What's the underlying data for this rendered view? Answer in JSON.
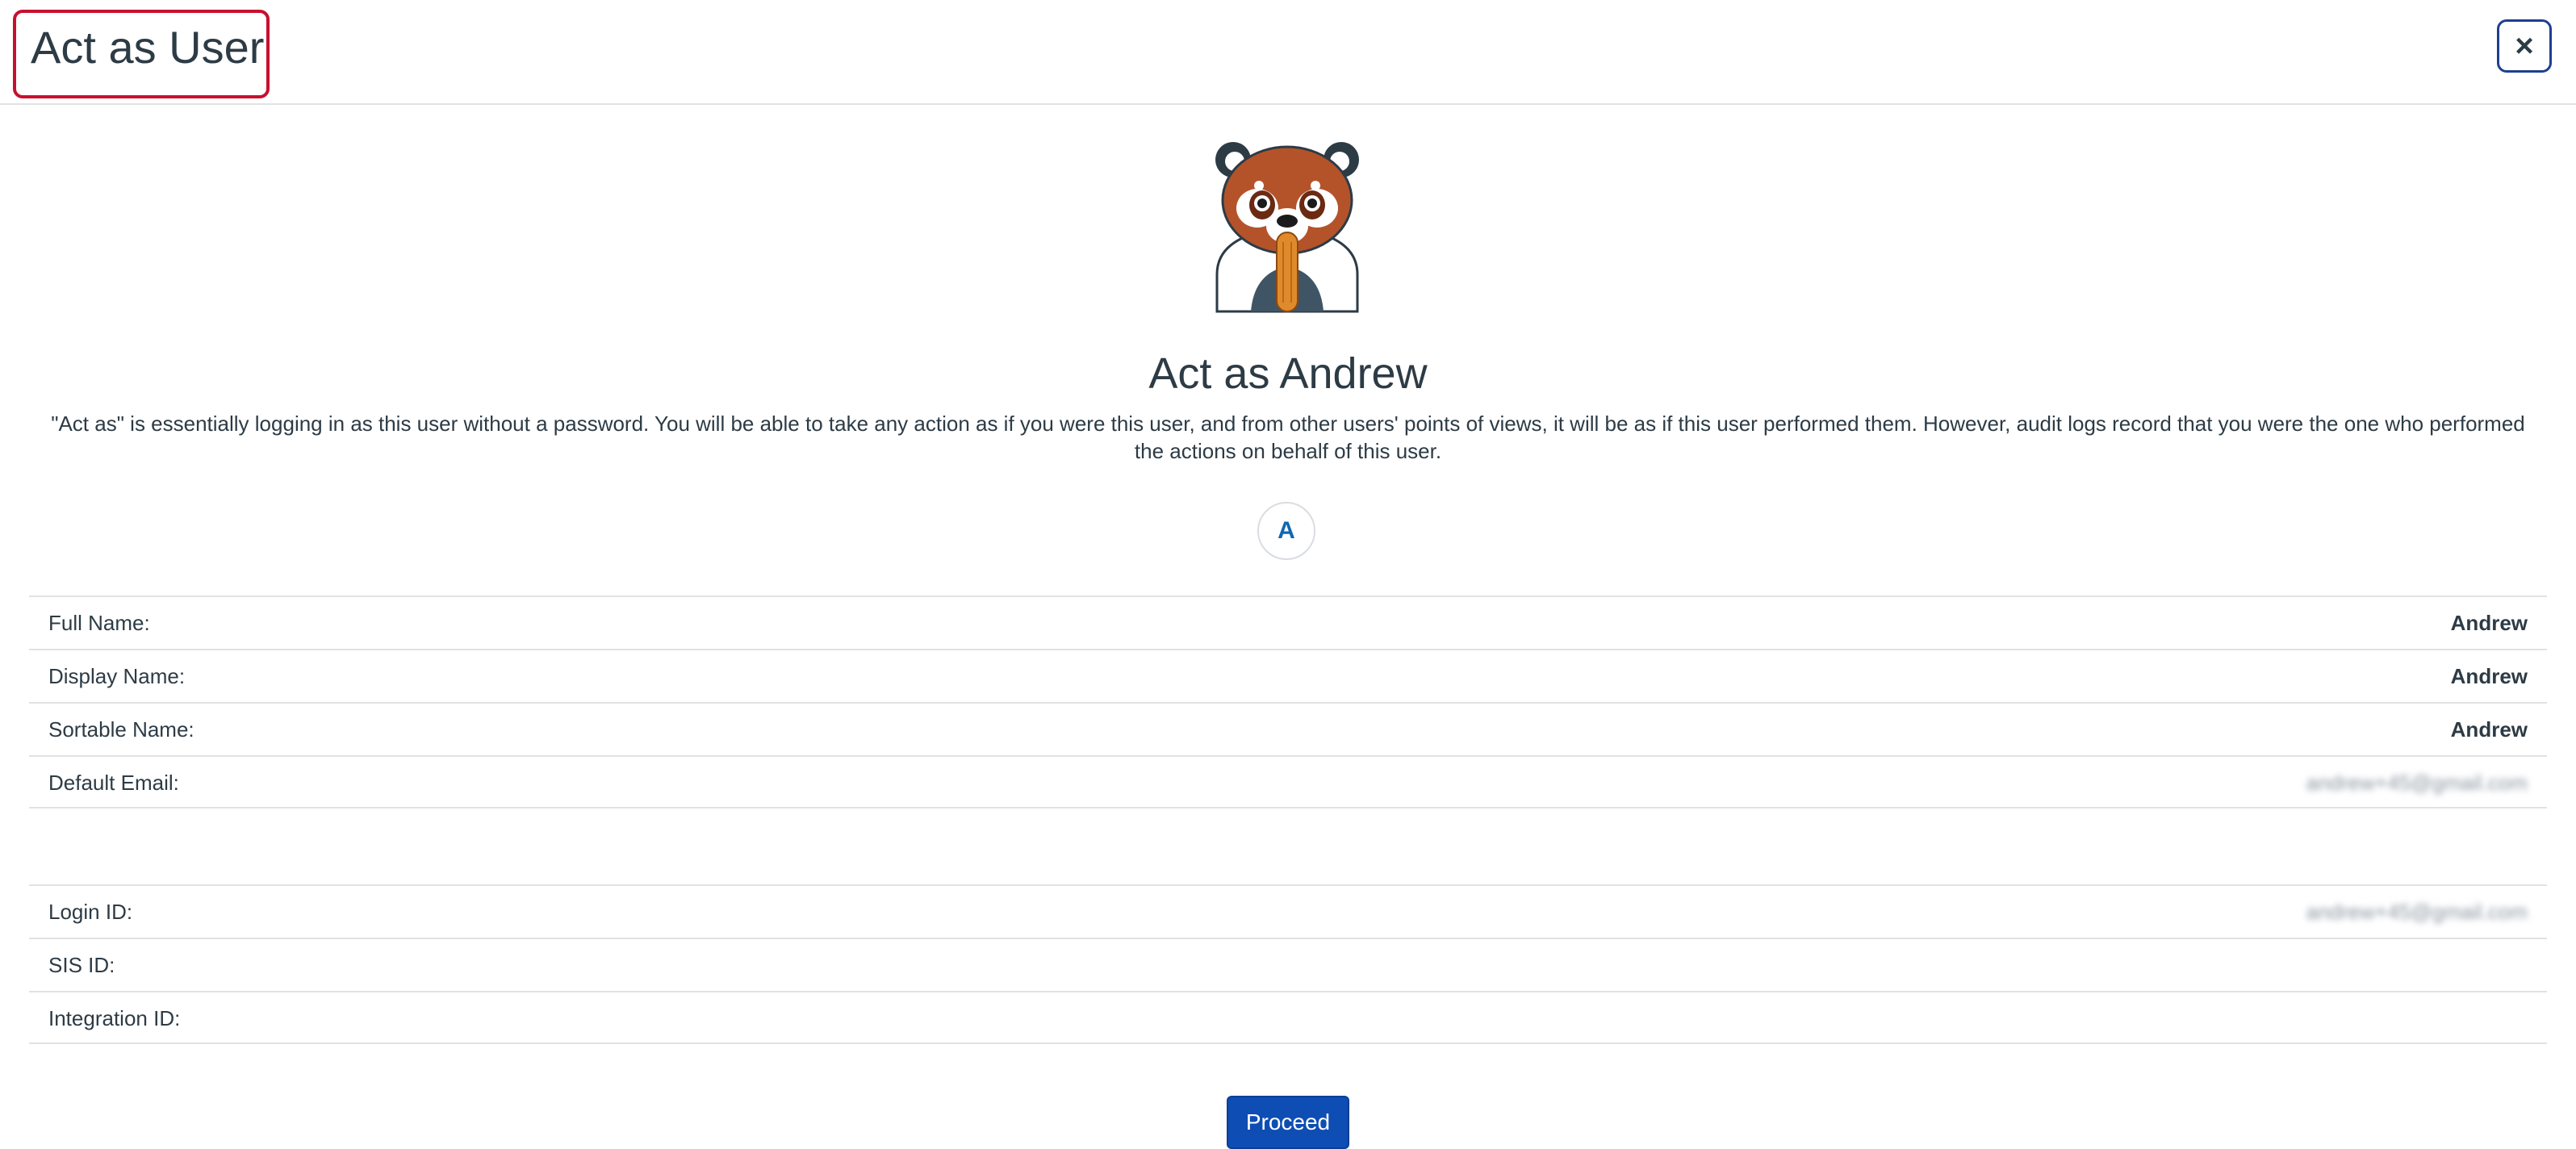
{
  "modal": {
    "title": "Act as User",
    "close_label": "×"
  },
  "user": {
    "heading": "Act as Andrew",
    "description": "\"Act as\" is essentially logging in as this user without a password. You will be able to take any action as if you were this user, and from other users' points of views, it will be as if this user performed them. However, audit logs record that you were the one who performed the actions on behalf of this user.",
    "avatar_initial": "A",
    "mascot_icon": "red-panda-icon"
  },
  "details": {
    "full_name_label": "Full Name:",
    "full_name": "Andrew",
    "display_name_label": "Display Name:",
    "display_name": "Andrew",
    "sortable_name_label": "Sortable Name:",
    "sortable_name": "Andrew",
    "default_email_label": "Default Email:",
    "default_email": "andrew+45@gmail.com",
    "login_id_label": "Login ID:",
    "login_id": "andrew+45@gmail.com",
    "sis_id_label": "SIS ID:",
    "sis_id": "",
    "integration_id_label": "Integration ID:",
    "integration_id": ""
  },
  "actions": {
    "proceed_label": "Proceed"
  },
  "colors": {
    "accent": "#0e4db3",
    "highlight_border": "#c8102e"
  }
}
